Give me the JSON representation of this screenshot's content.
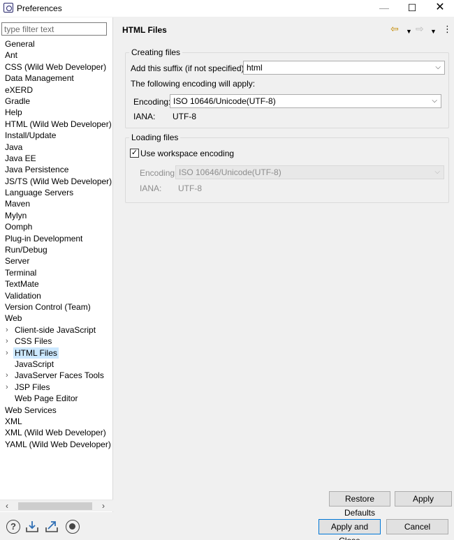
{
  "window": {
    "title": "Preferences"
  },
  "filter": {
    "placeholder": "type filter text"
  },
  "tree": {
    "items": [
      {
        "label": "General"
      },
      {
        "label": "Ant"
      },
      {
        "label": "CSS (Wild Web Developer)"
      },
      {
        "label": "Data Management"
      },
      {
        "label": "eXERD"
      },
      {
        "label": "Gradle"
      },
      {
        "label": "Help"
      },
      {
        "label": "HTML (Wild Web Developer)"
      },
      {
        "label": "Install/Update"
      },
      {
        "label": "Java"
      },
      {
        "label": "Java EE"
      },
      {
        "label": "Java Persistence"
      },
      {
        "label": "JS/TS (Wild Web Developer)"
      },
      {
        "label": "Language Servers"
      },
      {
        "label": "Maven"
      },
      {
        "label": "Mylyn"
      },
      {
        "label": "Oomph"
      },
      {
        "label": "Plug-in Development"
      },
      {
        "label": "Run/Debug"
      },
      {
        "label": "Server"
      },
      {
        "label": "Terminal"
      },
      {
        "label": "TextMate"
      },
      {
        "label": "Validation"
      },
      {
        "label": "Version Control (Team)"
      },
      {
        "label": "Web"
      },
      {
        "label": "Client-side JavaScript"
      },
      {
        "label": "CSS Files"
      },
      {
        "label": "HTML Files"
      },
      {
        "label": "JavaScript"
      },
      {
        "label": "JavaServer Faces Tools"
      },
      {
        "label": "JSP Files"
      },
      {
        "label": "Web Page Editor"
      },
      {
        "label": "Web Services"
      },
      {
        "label": "XML"
      },
      {
        "label": "XML (Wild Web Developer)"
      },
      {
        "label": "YAML (Wild Web Developer)"
      }
    ]
  },
  "page": {
    "title": "HTML Files",
    "creating": {
      "group_title": "Creating files",
      "suffix_label": "Add this suffix (if not specified):",
      "suffix_value": "html",
      "encoding_note": "The following encoding will apply:",
      "encoding_label": "Encoding:",
      "encoding_value": "ISO 10646/Unicode(UTF-8)",
      "iana_label": "IANA:",
      "iana_value": "UTF-8"
    },
    "loading": {
      "group_title": "Loading files",
      "workspace_label": "Use workspace encoding",
      "workspace_checked": true,
      "encoding_label": "Encoding:",
      "encoding_value": "ISO 10646/Unicode(UTF-8)",
      "iana_label": "IANA:",
      "iana_value": "UTF-8"
    }
  },
  "buttons": {
    "restore_defaults": "Restore Defaults",
    "apply": "Apply",
    "apply_and_close": "Apply and Close",
    "cancel": "Cancel"
  },
  "colors": {
    "selection": "#cce8ff",
    "default_button_border": "#0078d7"
  }
}
